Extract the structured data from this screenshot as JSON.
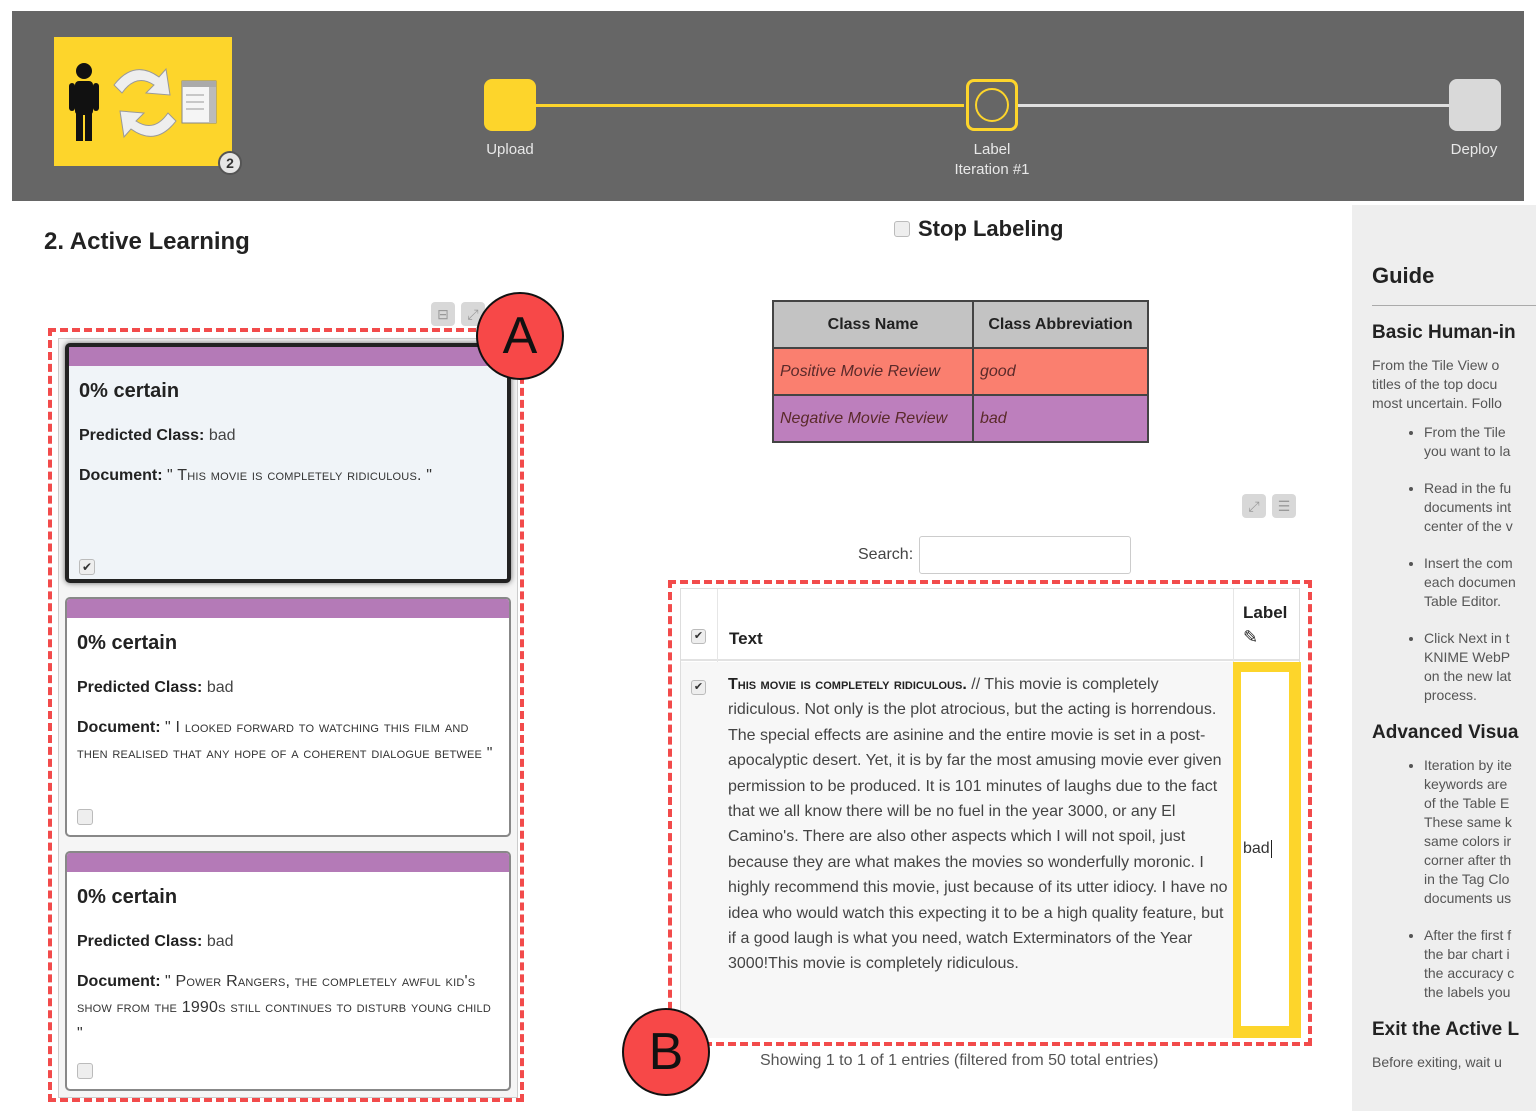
{
  "header": {
    "logo_badge": "2",
    "steps": [
      {
        "label": "Upload",
        "sublabel": "",
        "state": "done"
      },
      {
        "label": "Label",
        "sublabel": "Iteration #1",
        "state": "current"
      },
      {
        "label": "Deploy",
        "sublabel": "",
        "state": "pending"
      }
    ],
    "colors": {
      "active": "#fdd52b",
      "pending": "#d9d9d9",
      "bar": "#666666"
    }
  },
  "page": {
    "title": "2. Active Learning"
  },
  "annotations": {
    "a": "A",
    "b": "B",
    "color": "#f74848"
  },
  "tile_view": {
    "buttons": [
      "collapse-icon",
      "expand-icon"
    ],
    "tiles": [
      {
        "certainty": "0% certain",
        "predicted_label": "Predicted Class:",
        "predicted_value": "bad",
        "document_label": "Document:",
        "document_value": "\" This movie is completely ridiculous. \"",
        "checked": true,
        "selected": true
      },
      {
        "certainty": "0% certain",
        "predicted_label": "Predicted Class:",
        "predicted_value": "bad",
        "document_label": "Document:",
        "document_value": "\" I looked forward to watching this film and then realised that any hope of a coherent dialogue betwee \"",
        "checked": false,
        "selected": false
      },
      {
        "certainty": "0% certain",
        "predicted_label": "Predicted Class:",
        "predicted_value": "bad",
        "document_label": "Document:",
        "document_value": "\" Power Rangers, the completely awful kid's show from the 1990s still continues to disturb young child \"",
        "checked": false,
        "selected": false
      }
    ]
  },
  "stop_labeling": {
    "label": "Stop Labeling",
    "checked": false
  },
  "class_table": {
    "headers": [
      "Class Name",
      "Class Abbreviation"
    ],
    "rows": [
      {
        "name": "Positive Movie Review",
        "abbr": "good",
        "color": "#fa7f6f"
      },
      {
        "name": "Negative Movie Review",
        "abbr": "bad",
        "color": "#bd7fbd"
      }
    ]
  },
  "table_editor": {
    "buttons": [
      "expand-icon",
      "menu-icon"
    ],
    "search_label": "Search:",
    "search_value": "",
    "columns": [
      "Text",
      "Label"
    ],
    "header_checked": true,
    "rows": [
      {
        "checked": true,
        "lead": "This movie is completely ridiculous.",
        "text": " // This movie is completely ridiculous. Not only is the plot atrocious, but the acting is horrendous. The special effects are asinine and the entire movie is set in a post-apocalyptic desert. Yet, it is by far the most amusing movie ever given permission to be produced. It is 101 minutes of laughs due to the fact that we all know there will be no fuel in the year 3000, or any El Camino's. There are also other aspects which I will not spoil, just because they are what makes the movies so wonderfully moronic. I highly recommend this movie, just because of its utter idiocy. I have no idea who would watch this expecting it to be a high quality feature, but if a good laugh is what you need, watch Exterminators of the Year 3000!This movie is completely ridiculous.",
        "label": "bad"
      }
    ],
    "status": "Showing 1 to 1 of 1 entries (filtered from 50 total entries)"
  },
  "guide": {
    "title": "Guide",
    "sections": [
      {
        "heading": "Basic Human-in",
        "intro": [
          "From the Tile View o",
          "titles of the top docu",
          "most uncertain. Follo"
        ],
        "bullets": [
          [
            "From the Tile",
            "you want to la"
          ],
          [
            "Read in the fu",
            "documents int",
            "center of the v"
          ],
          [
            "Insert the com",
            "each documen",
            "Table Editor."
          ],
          [
            "Click Next in t",
            "KNIME WebP",
            "on the new lat",
            "process."
          ]
        ]
      },
      {
        "heading": "Advanced Visua",
        "intro": [],
        "bullets": [
          [
            "Iteration by ite",
            "keywords are",
            "of the Table E",
            "These same k",
            "same colors ir",
            "corner after th",
            "in the Tag Clo",
            "documents us"
          ],
          [
            "After the first f",
            "the bar chart i",
            "the accuracy c",
            "the labels you"
          ]
        ]
      },
      {
        "heading": "Exit the Active L",
        "intro": [
          "Before exiting, wait u"
        ],
        "bullets": []
      }
    ]
  }
}
